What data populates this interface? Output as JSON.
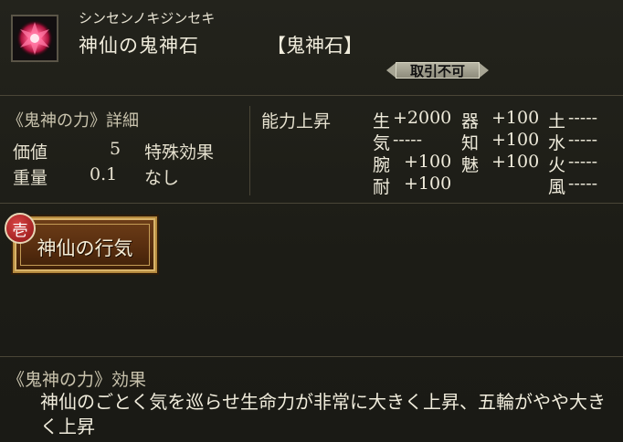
{
  "item": {
    "furigana": "シンセンノキジンセキ",
    "name": "神仙の鬼神石",
    "type": "【鬼神石】",
    "trade_status": "取引不可"
  },
  "details": {
    "title": "《鬼神の力》詳細",
    "rows": [
      {
        "label": "価値",
        "value": "5"
      },
      {
        "label": "重量",
        "value": "0.1"
      }
    ],
    "special_label": "特殊効果",
    "special_value": "なし"
  },
  "ability": {
    "title": "能力上昇",
    "stats": [
      {
        "name": "生",
        "value": "+2000"
      },
      {
        "name": "気",
        "value": "-----"
      },
      {
        "name": "腕",
        "value": "+100"
      },
      {
        "name": "耐",
        "value": "+100"
      },
      {
        "name": "器",
        "value": "+100"
      },
      {
        "name": "知",
        "value": "+100"
      },
      {
        "name": "魅",
        "value": "+100"
      },
      {
        "name": "土",
        "value": "-----"
      },
      {
        "name": "水",
        "value": "-----"
      },
      {
        "name": "火",
        "value": "-----"
      },
      {
        "name": "風",
        "value": "-----"
      }
    ]
  },
  "skill": {
    "seal": "壱",
    "label": "神仙の行気"
  },
  "effect": {
    "title": "《鬼神の力》効果",
    "text": "神仙のごとく気を巡らせ生命力が非常に大きく上昇、五輪がやや大きく上昇"
  },
  "colors": {
    "background": "#1d1d17",
    "skill_button": "#5a2f10",
    "seal": "#c22a2a"
  }
}
